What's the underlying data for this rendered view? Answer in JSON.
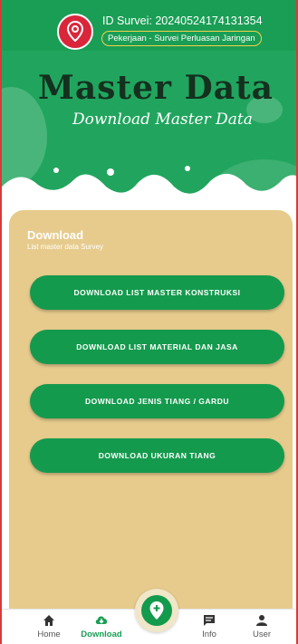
{
  "header": {
    "survey_id": "ID Survei: 20240524174131354",
    "job": "Pekerjaan - Survei Perluasan Jaringan"
  },
  "banner": {
    "title": "Master Data",
    "subtitle": "Download Master Data"
  },
  "card": {
    "title": "Download",
    "subtitle": "List master data Survey",
    "buttons": [
      "DOWNLOAD LIST MASTER KONSTRUKSI",
      "DOWNLOAD LIST MATERIAL DAN JASA",
      "DOWNLOAD JENIS TIANG / GARDU",
      "DOWNLOAD UKURAN TIANG"
    ]
  },
  "nav": {
    "items": [
      "Home",
      "Download",
      "Info",
      "User"
    ],
    "active": "Download"
  },
  "colors": {
    "primary": "#1a9e55",
    "accent_badge": "#f1d24a",
    "card_bg": "#e6cb8d",
    "pin": "#d9263b"
  }
}
